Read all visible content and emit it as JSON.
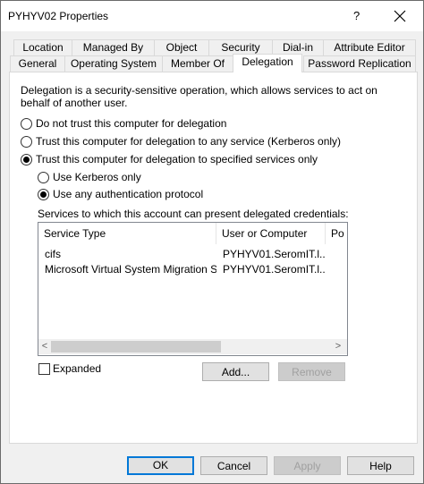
{
  "window": {
    "title": "PYHYV02 Properties",
    "help_glyph": "?",
    "close_glyph": "✕"
  },
  "tabs_row1": [
    "Location",
    "Managed By",
    "Object",
    "Security",
    "Dial-in",
    "Attribute Editor"
  ],
  "tabs_row2": [
    "General",
    "Operating System",
    "Member Of",
    "Delegation",
    "Password Replication"
  ],
  "delegation": {
    "description_line1": "Delegation is a security-sensitive operation, which allows services to act on",
    "description_line2": "behalf of another user.",
    "option_none": "Do not trust this computer for delegation",
    "option_any": "Trust this computer for delegation to any service (Kerberos only)",
    "option_specified": "Trust this computer for delegation to specified services only",
    "sub_kerberos": "Use Kerberos only",
    "sub_any_protocol": "Use any authentication protocol",
    "services_label": "Services to which this account can present delegated credentials:",
    "columns": [
      "Service Type",
      "User or Computer",
      "Po"
    ],
    "rows": [
      [
        "cifs",
        "PYHYV01.SeromIT.l..."
      ],
      [
        "Microsoft Virtual System Migration Ser...",
        "PYHYV01.SeromIT.l..."
      ]
    ],
    "scroll_left": "<",
    "scroll_right": ">",
    "expanded_label": "Expanded",
    "add_label": "Add...",
    "remove_label": "Remove"
  },
  "footer": {
    "ok": "OK",
    "cancel": "Cancel",
    "apply": "Apply",
    "help": "Help"
  }
}
